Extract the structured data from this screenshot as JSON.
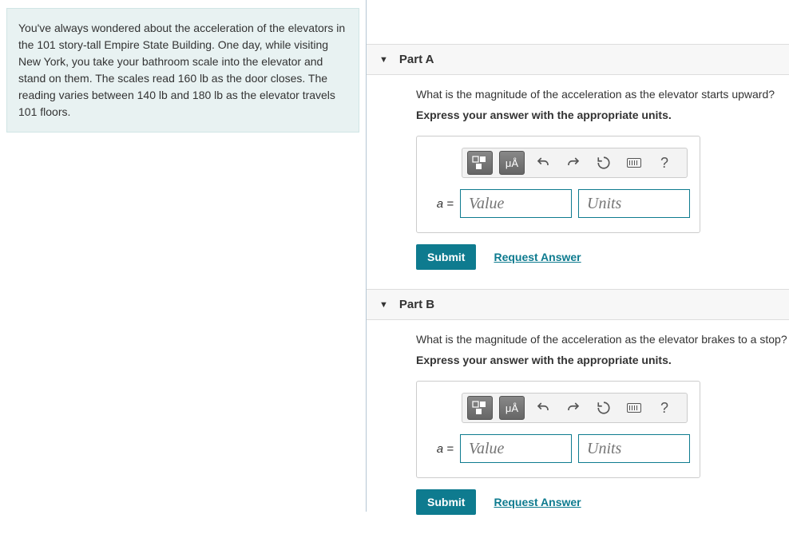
{
  "problem": {
    "text": "You've always wondered about the acceleration of the elevators in the 101 story-tall Empire State Building. One day, while visiting New York, you take your bathroom scale into the elevator and stand on them. The scales read 160 lb as the door closes. The reading varies between 140 lb and 180 lb as the elevator travels 101 floors."
  },
  "parts": [
    {
      "title": "Part A",
      "question": "What is the magnitude of the acceleration as the elevator starts upward?",
      "instruction": "Express your answer with the appropriate units.",
      "variable": "a =",
      "value_placeholder": "Value",
      "units_placeholder": "Units",
      "submit_label": "Submit",
      "request_label": "Request Answer"
    },
    {
      "title": "Part B",
      "question": "What is the magnitude of the acceleration as the elevator brakes to a stop?",
      "instruction": "Express your answer with the appropriate units.",
      "variable": "a =",
      "value_placeholder": "Value",
      "units_placeholder": "Units",
      "submit_label": "Submit",
      "request_label": "Request Answer"
    }
  ],
  "toolbar": {
    "template_label": "▯▯",
    "units_label": "µÅ",
    "undo_label": "↶",
    "redo_label": "↷",
    "reset_label": "↻",
    "keyboard_label": "⌨",
    "help_label": "?"
  }
}
